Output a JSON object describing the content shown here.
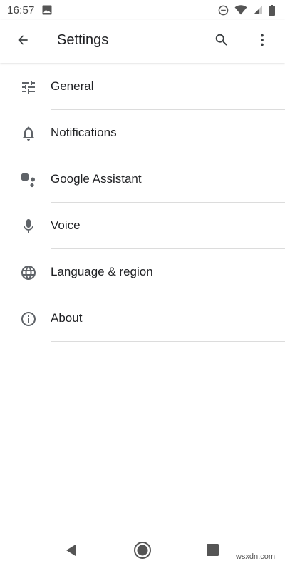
{
  "status_bar": {
    "time": "16:57",
    "icons": [
      "image-icon",
      "do-not-disturb-icon",
      "wifi-icon",
      "cell-signal-icon",
      "battery-icon"
    ]
  },
  "app_bar": {
    "title": "Settings",
    "icons": [
      "back-arrow-icon",
      "search-icon",
      "more-vert-icon"
    ]
  },
  "settings": {
    "items": [
      {
        "label": "General",
        "icon": "tune-icon"
      },
      {
        "label": "Notifications",
        "icon": "bell-icon"
      },
      {
        "label": "Google Assistant",
        "icon": "assistant-icon"
      },
      {
        "label": "Voice",
        "icon": "microphone-icon"
      },
      {
        "label": "Language & region",
        "icon": "globe-icon"
      },
      {
        "label": "About",
        "icon": "info-icon"
      }
    ]
  },
  "nav_bar": {
    "icons": [
      "nav-back-icon",
      "nav-home-icon",
      "nav-recents-icon"
    ]
  },
  "watermark": "wsxdn.com",
  "colors": {
    "icon": "#5f6368",
    "text": "#202124",
    "divider": "#dcdcdc"
  }
}
